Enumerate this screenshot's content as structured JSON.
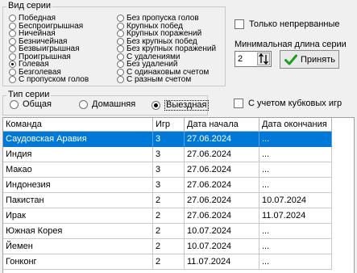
{
  "series_kind": {
    "title": "Вид серии",
    "left": [
      {
        "label": "Победная",
        "selected": false
      },
      {
        "label": "Беспроигрышная",
        "selected": false
      },
      {
        "label": "Ничейная",
        "selected": false
      },
      {
        "label": "Безничейная",
        "selected": false
      },
      {
        "label": "Безвыигрышная",
        "selected": false
      },
      {
        "label": "Проигрышная",
        "selected": false
      },
      {
        "label": "Голевая",
        "selected": true
      },
      {
        "label": "Безголевая",
        "selected": false
      },
      {
        "label": "С пропуском голов",
        "selected": false
      }
    ],
    "right": [
      {
        "label": "Без пропуска голов",
        "selected": false
      },
      {
        "label": "Крупных побед",
        "selected": false
      },
      {
        "label": "Крупных поражений",
        "selected": false
      },
      {
        "label": "Без крупных побед",
        "selected": false
      },
      {
        "label": "Без крупных поражений",
        "selected": false
      },
      {
        "label": "С удалениями",
        "selected": false
      },
      {
        "label": "Без удалений",
        "selected": false
      },
      {
        "label": "С одинаковым счетом",
        "selected": false
      },
      {
        "label": "С разным счетом",
        "selected": false
      }
    ]
  },
  "only_continuous": {
    "label": "Только непрерванные",
    "checked": false
  },
  "min_length": {
    "label": "Минимальная длина серии",
    "value": "2"
  },
  "accept_button": {
    "label": "Принять",
    "icon": "check-icon"
  },
  "series_type": {
    "title": "Тип серии",
    "options": [
      {
        "label": "Общая",
        "selected": false
      },
      {
        "label": "Домашняя",
        "selected": false
      },
      {
        "label": "Выездная",
        "selected": true
      }
    ]
  },
  "cup_games": {
    "label": "С учетом кубковых игр",
    "checked": false
  },
  "table": {
    "columns": [
      "Команда",
      "Игр",
      "Дата начала",
      "Дата окончания"
    ],
    "rows": [
      {
        "team": "Саудовская Аравия",
        "games": "3",
        "start": "27.06.2024",
        "end": "...",
        "selected": true
      },
      {
        "team": "Индия",
        "games": "3",
        "start": "27.06.2024",
        "end": "...",
        "selected": false
      },
      {
        "team": "Макао",
        "games": "3",
        "start": "27.06.2024",
        "end": "...",
        "selected": false
      },
      {
        "team": "Индонезия",
        "games": "3",
        "start": "27.06.2024",
        "end": "...",
        "selected": false
      },
      {
        "team": "Пакистан",
        "games": "2",
        "start": "27.06.2024",
        "end": "10.07.2024",
        "selected": false
      },
      {
        "team": "Ирак",
        "games": "2",
        "start": "27.06.2024",
        "end": "11.07.2024",
        "selected": false
      },
      {
        "team": "Южная Корея",
        "games": "2",
        "start": "10.07.2024",
        "end": "...",
        "selected": false
      },
      {
        "team": "Йемен",
        "games": "2",
        "start": "10.07.2024",
        "end": "...",
        "selected": false
      },
      {
        "team": "Гонконг",
        "games": "2",
        "start": "11.07.2024",
        "end": "...",
        "selected": false
      }
    ]
  },
  "colors": {
    "selection": "#0078d7",
    "accept_check": "#1e9e1e"
  }
}
